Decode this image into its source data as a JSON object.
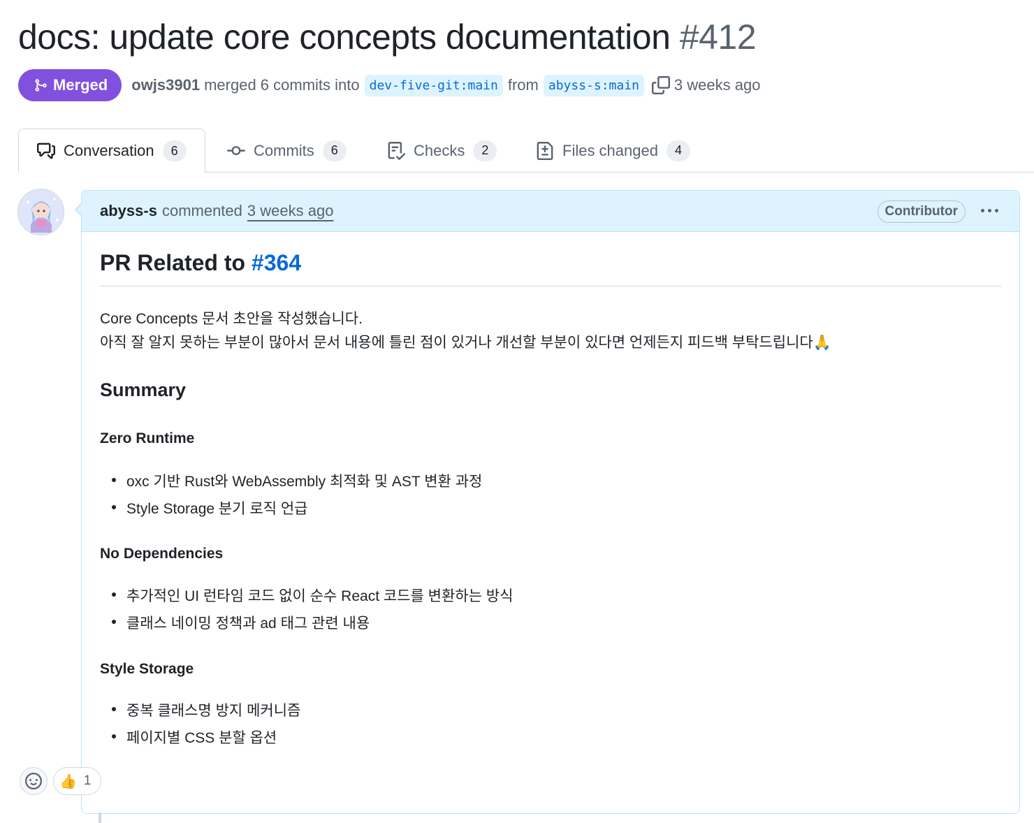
{
  "pr": {
    "title": "docs: update core concepts documentation",
    "number": "#412",
    "status": "Merged",
    "author": "owjs3901",
    "merged_text": "merged 6 commits into",
    "base_branch": "dev-five-git:main",
    "from_text": "from",
    "head_branch": "abyss-s:main",
    "time": "3 weeks ago"
  },
  "tabs": [
    {
      "label": "Conversation",
      "count": "6",
      "icon": "conversation-icon"
    },
    {
      "label": "Commits",
      "count": "6",
      "icon": "commit-icon"
    },
    {
      "label": "Checks",
      "count": "2",
      "icon": "checklist-icon"
    },
    {
      "label": "Files changed",
      "count": "4",
      "icon": "file-diff-icon"
    }
  ],
  "comment": {
    "author": "abyss-s",
    "action": "commented",
    "time": "3 weeks ago",
    "role": "Contributor",
    "heading": "PR Related to",
    "heading_ref": "#364",
    "intro_1": "Core Concepts 문서 초안을 작성했습니다.",
    "intro_2": "아직 잘 알지 못하는 부분이 많아서 문서 내용에 틀린 점이 있거나 개선할 부분이 있다면 언제든지 피드백 부탁드립니다🙏",
    "summary": "Summary",
    "sections": [
      {
        "title": "Zero Runtime",
        "items": [
          "oxc 기반 Rust와 WebAssembly 최적화 및 AST 변환 과정",
          "Style Storage 분기 로직 언급"
        ]
      },
      {
        "title": "No Dependencies",
        "items": [
          "추가적인 UI 런타임 코드 없이 순수 React 코드를 변환하는 방식",
          "클래스 네이밍 정책과 ad 태그 관련 내용"
        ]
      },
      {
        "title": "Style Storage",
        "items": [
          "중복 클래스명 방지 메커니즘",
          "페이지별 CSS 분할 옵션"
        ]
      }
    ],
    "reactions": {
      "emoji": "👍",
      "count": "1"
    }
  },
  "colors": {
    "merged": "#8250df",
    "link": "#0969da",
    "header_bg": "#ddf4ff"
  }
}
